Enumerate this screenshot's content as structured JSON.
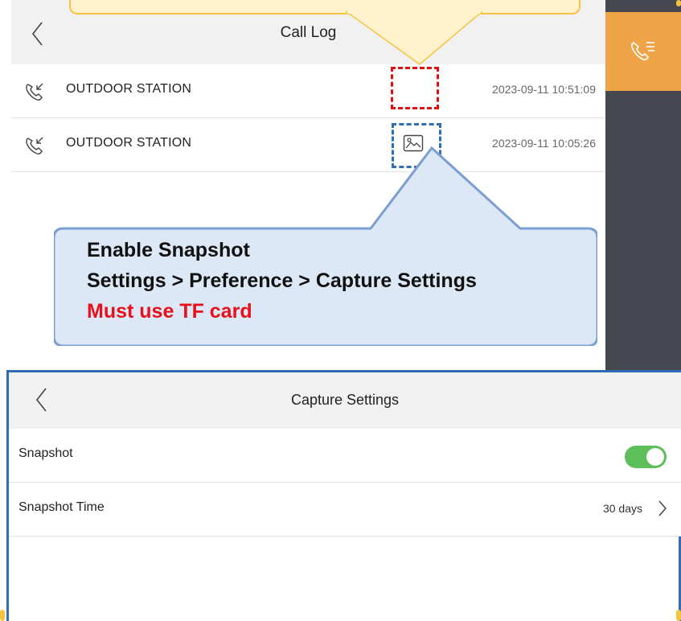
{
  "call_log": {
    "title": "Call Log",
    "entries": [
      {
        "name": "OUTDOOR STATION",
        "time": "2023-09-11 10:51:09",
        "has_snapshot": false
      },
      {
        "name": "OUTDOOR STATION",
        "time": "2023-09-11 10:05:26",
        "has_snapshot": true
      }
    ],
    "side_tab_icon": "call-log-icon"
  },
  "annotation": {
    "lines": [
      "Enable Snapshot",
      "Settings > Preference > Capture Settings"
    ],
    "warning": "Must use TF card"
  },
  "capture_settings": {
    "title": "Capture Settings",
    "snapshot_label": "Snapshot",
    "snapshot_enabled": true,
    "snapshot_time_label": "Snapshot Time",
    "snapshot_time_value": "30 days"
  },
  "colors": {
    "accent_orange": "#f0a448",
    "sidebar_dark": "#474752",
    "toggle_on": "#5cbf5c",
    "callout_fill": "#dce8f5",
    "callout_border": "#7a9fd0",
    "annotation_red": "#e8101a"
  }
}
